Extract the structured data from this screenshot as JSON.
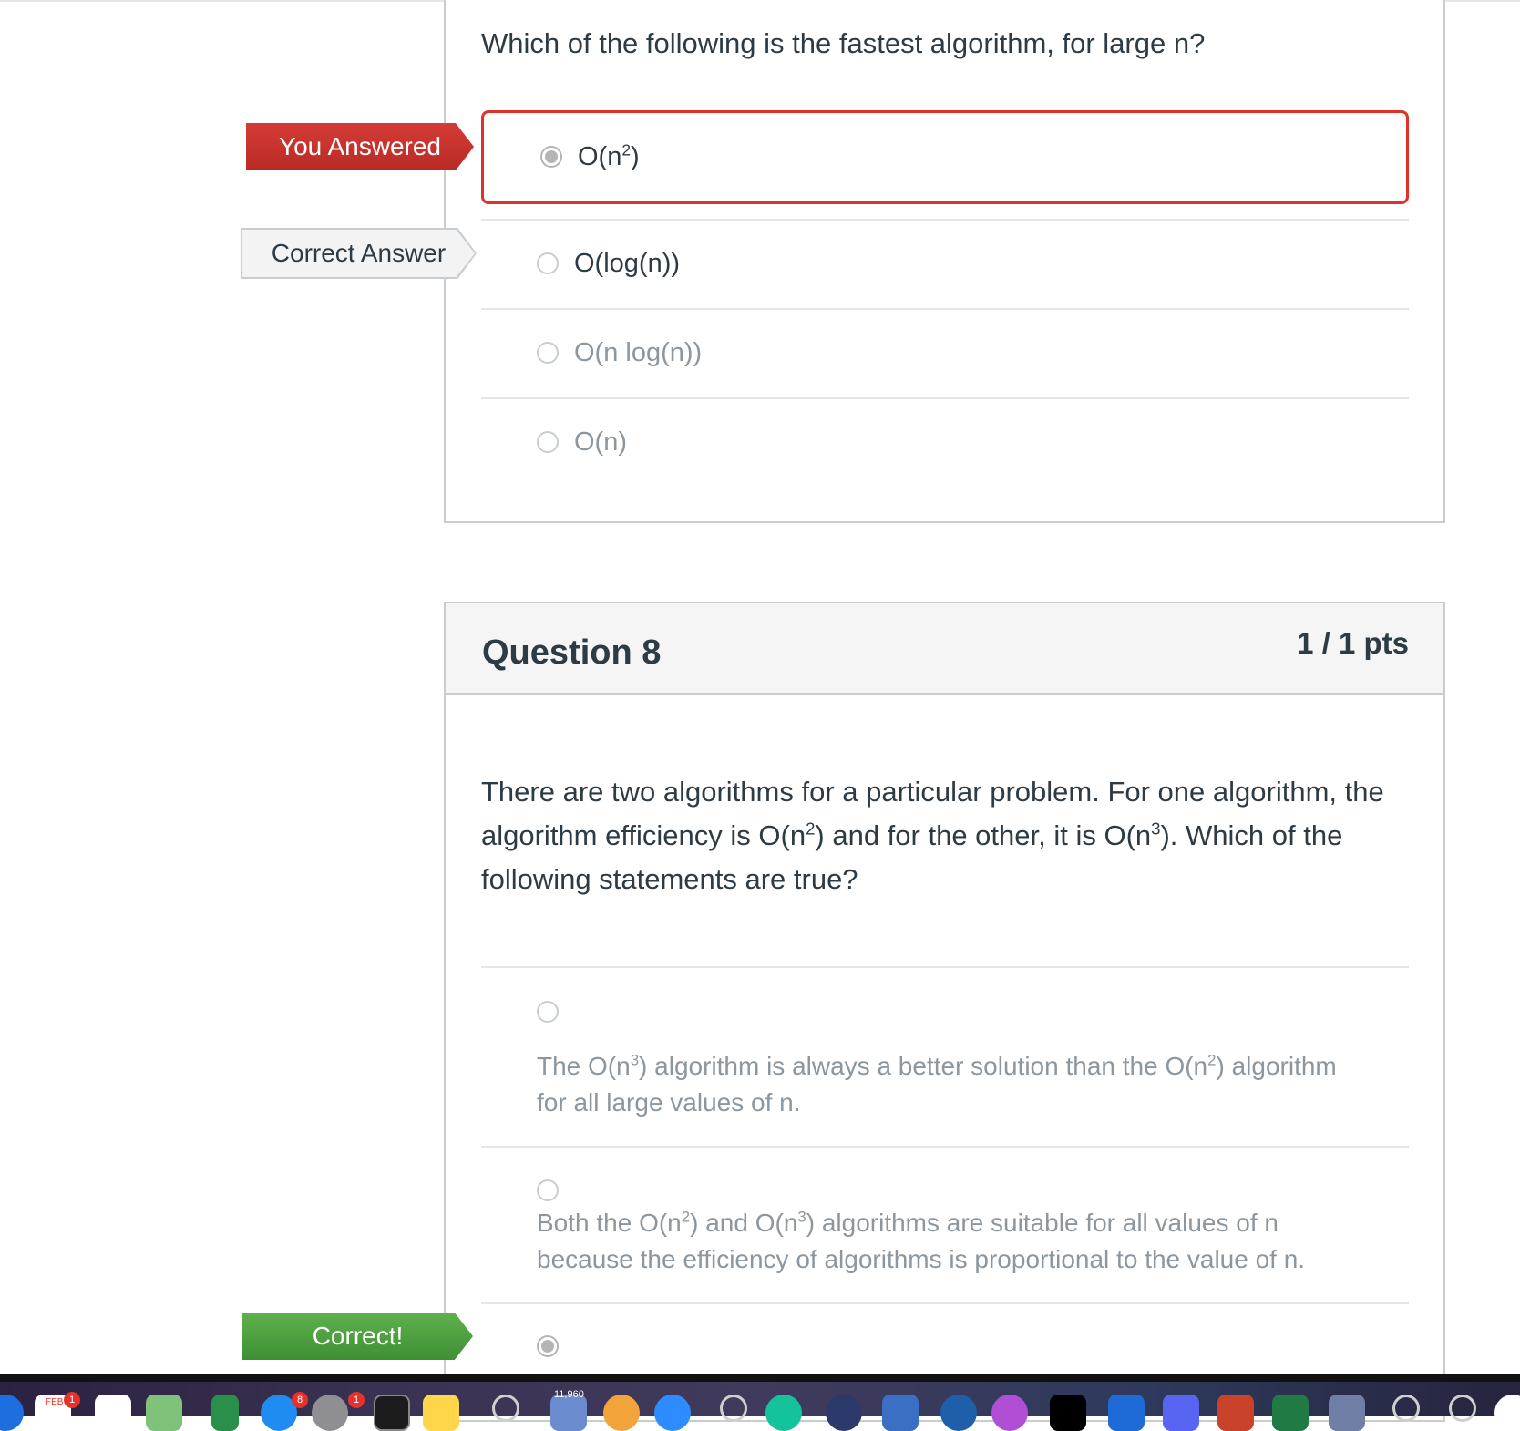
{
  "question7": {
    "prompt": "Which of the following is the fastest algorithm, for large n?",
    "answers": [
      {
        "label": "O(n",
        "sup": "2",
        "tail": ")",
        "selected": true,
        "state": "You Answered"
      },
      {
        "label": "O(log(n))",
        "selected": false,
        "state": "Correct Answer"
      },
      {
        "label": "O(n log(n))",
        "selected": false
      },
      {
        "label": "O(n)",
        "selected": false
      }
    ],
    "flags": {
      "you_answered": "You Answered",
      "correct_answer": "Correct Answer"
    }
  },
  "question8": {
    "title": "Question 8",
    "points": "1 / 1 pts",
    "prompt": {
      "line1": "There are two algorithms for a particular problem. For one algorithm, the",
      "line2_a": "algorithm efficiency is O(n",
      "line2_sup1": "2",
      "line2_b": ") and for the other, it is O(n",
      "line2_sup2": "3",
      "line2_c": "). Which of the",
      "line3": "following statements are true?"
    },
    "answers": [
      {
        "l1_a": "The O(n",
        "l1_sup1": "3",
        "l1_b": ") algorithm is always a better solution than the O(n",
        "l1_sup2": "2",
        "l1_c": ") algorithm",
        "l2": "for all large values of n."
      },
      {
        "l1_a": "Both the O(n",
        "l1_sup1": "2",
        "l1_b": ") and O(n",
        "l1_sup2": "3",
        "l1_c": ") algorithms are suitable for all values of n",
        "l2": "because the efficiency of algorithms is proportional to the value of n."
      }
    ],
    "flag_correct": "Correct!"
  },
  "dock": {
    "calendar_month": "FEB",
    "calendar_badge": "1",
    "appstore_badge": "8",
    "settings_badge": "1",
    "mail_count": "11,960"
  }
}
